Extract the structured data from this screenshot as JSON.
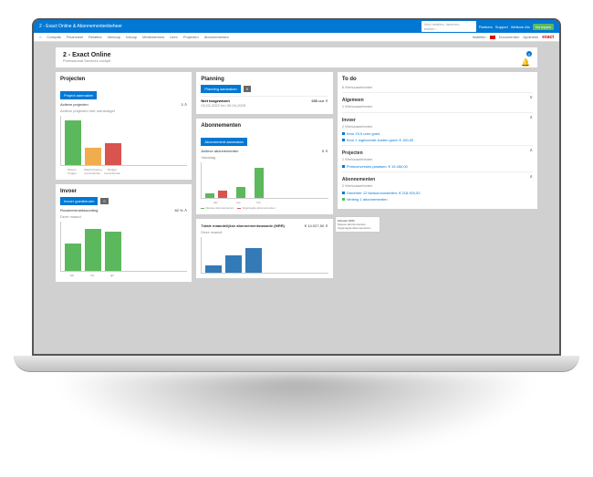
{
  "topbar": {
    "title": "2 - Exact Online & Abonnementenbeheer",
    "search_placeholder": "Vind relaties, facturen, boekin...",
    "links": [
      "Partners",
      "Support",
      "Welkom Alo"
    ],
    "cta": "Nu kopen"
  },
  "nav": {
    "home_icon": "⌂",
    "items": [
      "Cockpits",
      "Financieel",
      "Relaties",
      "Verkoop",
      "Inkoop",
      "Medewerkers",
      "Uren",
      "Projecten",
      "Abonnementen"
    ],
    "right": [
      "Instellen",
      "Documenten",
      "Apotheek"
    ],
    "brand": "exact"
  },
  "header": {
    "title": "2 - Exact Online",
    "subtitle": "Professional Services cockpit",
    "badge": "0"
  },
  "projecten": {
    "title": "Projecten",
    "btn": "Project aanmaken",
    "sub_title": "Actieve projecten",
    "sub_desc": "Actieve projecten met urenbudget",
    "count": "3",
    "chev": "∧"
  },
  "invoer": {
    "title": "Invoer",
    "btn": "Invoer goedkeuren",
    "badge": "0",
    "sub_title": "Roosterverantwoording",
    "sub_desc": "Deze maand",
    "val": "82 %",
    "chev": "∧"
  },
  "planning": {
    "title": "Planning",
    "btn": "Planning aanmaken",
    "badge": "0",
    "row_title": "Niet toegewezen",
    "row_desc": "03-02-2022 t/m 30-04-2025",
    "row_val": "655 uur",
    "chev": "∨"
  },
  "abon": {
    "title": "Abonnementen",
    "btn": "Abonnement aanmaken",
    "sub_title": "Actieve abonnementen",
    "sub_desc": "Vandaag",
    "count": "5",
    "chev": "∧",
    "legend": [
      "Nieuwe abonnementen",
      "Opgezegde abonnementen"
    ],
    "popup_title": "februari 2022",
    "popup_l1": "Nieuwe abonnementen",
    "popup_l2": "Opgezegde abonnementen"
  },
  "mrr": {
    "title": "Totale maandelijkse abonnementswaarde (MRR)",
    "sub": "Deze maand",
    "val": "€ 14.027,50",
    "chev": "∧"
  },
  "todo": {
    "title": "To do",
    "subtitle": "6 Werkzaamheden",
    "chev": "∨",
    "sections": [
      {
        "h": "Algemeen",
        "s": "1 Werkzaamheden",
        "items": []
      },
      {
        "h": "Invoer",
        "s": "2 Werkzaamheden",
        "items": [
          "Keur 15,5 uren goed",
          "Keur 1 ingevoerde kosten goed: € 150,00"
        ]
      },
      {
        "h": "Projecten",
        "s": "1 Werkzaamheden",
        "items": [
          "Printconversies plaatsen: € 19.450,00"
        ]
      },
      {
        "h": "Abonnementen",
        "s": "2 Werkzaamheden",
        "items": [
          "Genereer 12 factuurvoorstellen: € 218.920,52",
          "Verleng 1 abonnementen"
        ]
      }
    ]
  },
  "chart_data": [
    {
      "type": "bar",
      "card": "projecten",
      "categories": [
        "Binnen budget",
        "Waarschuwing overschreden",
        "Budget overschreden"
      ],
      "values": [
        1,
        0.4,
        0.5
      ],
      "colors": [
        "#5cb85c",
        "#f0ad4e",
        "#d9534f"
      ],
      "ylim": [
        0,
        1
      ]
    },
    {
      "type": "bar",
      "card": "invoer",
      "categories": [
        "feb",
        "mrt",
        "apr"
      ],
      "values": [
        55,
        85,
        80
      ],
      "colors": [
        "#5cb85c",
        "#5cb85c",
        "#5cb85c"
      ],
      "ylim": [
        0,
        100
      ]
    },
    {
      "type": "bar",
      "card": "abon",
      "categories": [
        "dec",
        "jan",
        "feb"
      ],
      "series": [
        {
          "name": "Nieuwe",
          "values": [
            5,
            12,
            35
          ],
          "color": "#5cb85c"
        },
        {
          "name": "Opgezegde",
          "values": [
            8,
            0,
            0
          ],
          "color": "#d9534f"
        }
      ],
      "ylim": [
        0,
        40
      ]
    },
    {
      "type": "bar",
      "card": "mrr",
      "categories": [
        "1",
        "2",
        "3"
      ],
      "values": [
        20,
        50,
        70
      ],
      "colors": [
        "#337ab7",
        "#337ab7",
        "#337ab7"
      ],
      "ylim": [
        0,
        100
      ]
    }
  ]
}
